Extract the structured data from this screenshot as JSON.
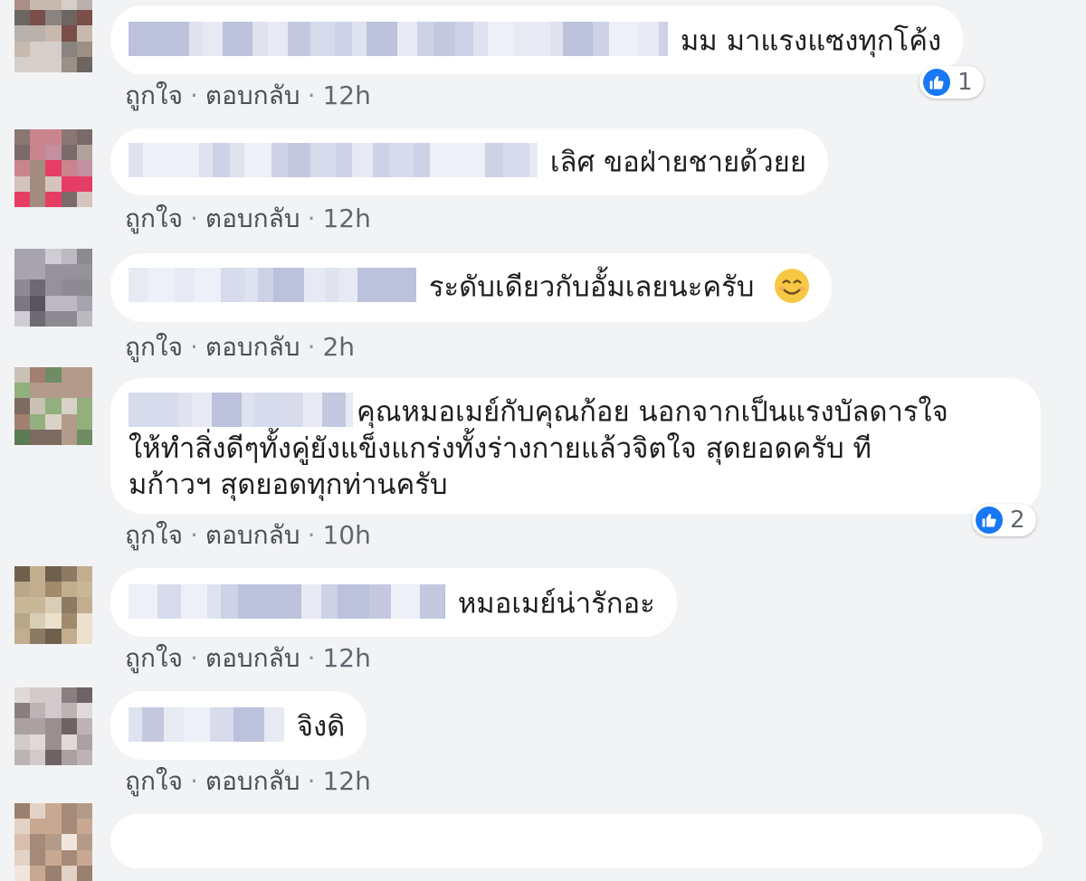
{
  "action_labels": {
    "like": "ถูกใจ",
    "reply": "ตอบกลับ",
    "separator": "·"
  },
  "colors": {
    "background": "#f2f3f5",
    "bubble": "#ffffff",
    "link": "#4b4f56",
    "like_blue": "#1877f2"
  },
  "comments": [
    {
      "name_blurred": true,
      "text": "มม มาแรงแซงทุกโค้ง",
      "time": "12h",
      "reactions": {
        "icon": "like-icon",
        "count": "1"
      }
    },
    {
      "name_blurred": true,
      "text": "เลิศ ขอฝ่ายชายด้วยย",
      "time": "12h"
    },
    {
      "name_blurred": true,
      "text": "ระดับเดียวกับอั้มเลยนะครับ",
      "emoji": "smiling-face-icon",
      "time": "2h"
    },
    {
      "name_blurred": true,
      "text": "คุณหมอเมย์กับคุณก้อย นอกจากเป็นแรงบัลดารใจ ให้ทำสิ่งดีๆทั้งคู่ยังแข็งแกร่งทั้งร่างกายแล้วจิตใจ สุดยอดครับ ที มก้าวฯ สุดยอดทุกท่านครับ",
      "lines": [
        "คุณหมอเมย์กับคุณก้อย นอกจากเป็นแรงบัลดารใจ",
        "ให้ทำสิ่งดีๆทั้งคู่ยังแข็งแกร่งทั้งร่างกายแล้วจิตใจ สุดยอดครับ ที",
        "มก้าวฯ สุดยอดทุกท่านครับ"
      ],
      "time": "10h",
      "reactions": {
        "icon": "like-icon",
        "count": "2"
      }
    },
    {
      "name_blurred": true,
      "text": "หมอเมย์น่ารักอะ",
      "time": "12h"
    },
    {
      "name_blurred": true,
      "text": "จิงดิ",
      "time": "12h"
    }
  ]
}
